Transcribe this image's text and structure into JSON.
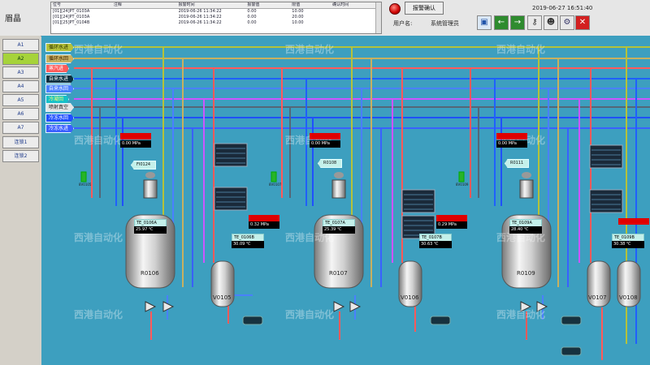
{
  "header": {
    "app_title": "眉晶",
    "alarm_table": {
      "columns": [
        "位号",
        "注释",
        "报警时间",
        "报警值",
        "限值",
        "确认时间"
      ],
      "rows": [
        [
          "[01][24]PT_0103A",
          "",
          "2019-06-26 11:34:22",
          "0.00",
          "10.00",
          ""
        ],
        [
          "[01][24]PT_0103A",
          "",
          "2019-06-26 11:34:22",
          "0.00",
          "20.00",
          ""
        ],
        [
          "[01][25]PT_0104B",
          "",
          "2019-06-26 11:34:22",
          "0.00",
          "10.00",
          ""
        ]
      ]
    },
    "ack_label": "报警确认",
    "datetime": "2019-06-27 16:51:40",
    "user_label": "用户名:",
    "user_value": "系统管理员"
  },
  "nav": [
    "A1",
    "A2",
    "A3",
    "A4",
    "A5",
    "A6",
    "A7",
    "连锁1",
    "连锁2"
  ],
  "active_nav": "A2",
  "pipes": [
    "循环水进",
    "循环水回",
    "蒸汽进",
    "自来水进",
    "自来水回",
    "冷凝回",
    "喷射真空",
    "冷冻水回",
    "冷冻水进"
  ],
  "watermark": "西港自动化",
  "units": [
    {
      "pressure_value": "0.00",
      "pressure_unit": "MPa",
      "flow_tag": "FI0124",
      "press_alarm": "0.32",
      "press_unit2": "MPa",
      "temp_label": "TE_0106A",
      "temp_value": "25.97",
      "temp_unit": "℃",
      "aux_temp_label": "TE_0106B",
      "aux_temp_value": "30.09",
      "aux_temp_unit": "℃",
      "reactor": "R0106",
      "tank": "V0105",
      "valve_label": "8V0105"
    },
    {
      "pressure_value": "0.00",
      "pressure_unit": "MPa",
      "flow_tag": "R0108",
      "press_alarm": "0.29",
      "press_unit2": "MPa",
      "temp_label": "TE_0107A",
      "temp_value": "25.39",
      "temp_unit": "℃",
      "aux_temp_label": "TE_0107B",
      "aux_temp_value": "30.63",
      "aux_temp_unit": "℃",
      "reactor": "R0107",
      "tank": "V0106",
      "valve_label": "8V0107"
    },
    {
      "pressure_value": "0.00",
      "pressure_unit": "MPa",
      "flow_tag": "R0111",
      "press_alarm": "",
      "press_unit2": "",
      "temp_label": "TE_0109A",
      "temp_value": "28.40",
      "temp_unit": "℃",
      "aux_temp_label": "TE_0109B",
      "aux_temp_value": "30.38",
      "aux_temp_unit": "℃",
      "reactor": "R0109",
      "tank": "V0107",
      "valve_label": "8V0109"
    }
  ],
  "tank_v0108": "V0108",
  "colors": {
    "bg": "#3d9fbf",
    "accent": "#a6d33a",
    "alarm": "#e00000"
  }
}
